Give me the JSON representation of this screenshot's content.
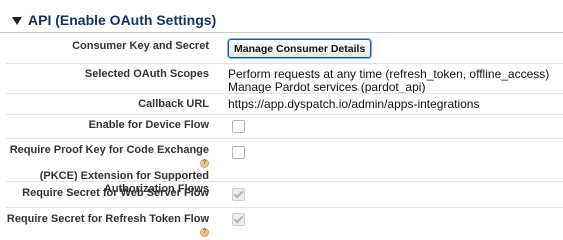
{
  "section": {
    "title": "API (Enable OAuth Settings)"
  },
  "fields": {
    "consumer_key_label": "Consumer Key and Secret",
    "consumer_key_button": "Manage Consumer Details",
    "scopes_label": "Selected OAuth Scopes",
    "scopes": [
      "Perform requests at any time (refresh_token, offline_access)",
      "Manage Pardot services (pardot_api)"
    ],
    "callback_label": "Callback URL",
    "callback_value": "https://app.dyspatch.io/admin/apps-integrations",
    "device_flow_label": "Enable for Device Flow",
    "device_flow_checked": false,
    "pkce_label_lines": [
      "Require Proof Key for Code Exchange",
      "(PKCE) Extension for Supported",
      "Authorization Flows"
    ],
    "pkce_checked": false,
    "web_server_label": "Require Secret for Web Server Flow",
    "web_server_checked": true,
    "refresh_token_label": "Require Secret for Refresh Token Flow",
    "refresh_token_checked": true
  },
  "icons": {
    "help": "help-icon",
    "collapse": "triangle-down-icon"
  },
  "colors": {
    "header_text": "#16325c",
    "label_text": "#333333",
    "button_border": "#1b5297",
    "help_icon": "#e8c79c"
  }
}
